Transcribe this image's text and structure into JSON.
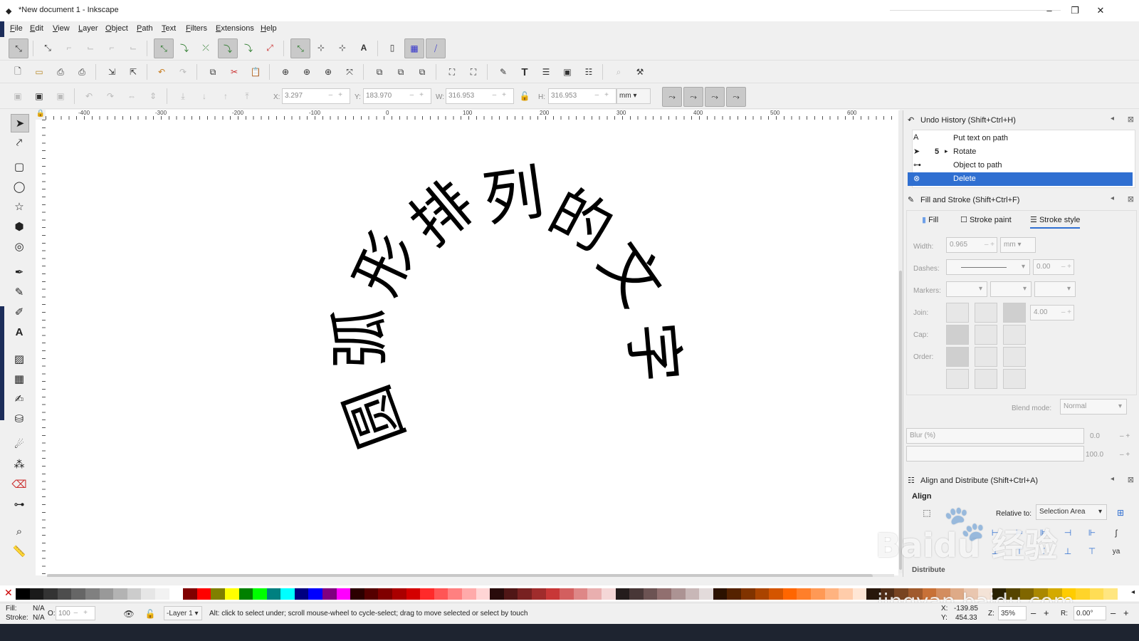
{
  "window": {
    "title": "*New document 1 - Inkscape",
    "controls": [
      "–",
      "❐",
      "✕"
    ]
  },
  "menu": [
    "File",
    "Edit",
    "View",
    "Layer",
    "Object",
    "Path",
    "Text",
    "Filters",
    "Extensions",
    "Help"
  ],
  "selector_toolbar": {
    "x_label": "X:",
    "x_value": "3.297",
    "y_label": "Y:",
    "y_value": "183.970",
    "w_label": "W:",
    "w_value": "316.953",
    "h_label": "H:",
    "h_value": "316.953",
    "unit": "mm"
  },
  "rulers": {
    "horizontal_ticks": [
      "-400",
      "-300",
      "-200",
      "-100",
      "0",
      "100",
      "200",
      "300",
      "400",
      "500",
      "600"
    ]
  },
  "canvas": {
    "arc_text": [
      "圆",
      "弧",
      "形",
      "排",
      "列",
      "的",
      "文",
      "字"
    ]
  },
  "undo_history": {
    "title": "Undo History (Shift+Ctrl+H)",
    "items": [
      {
        "icon": "text-icon",
        "count": "",
        "label": "Put text on path"
      },
      {
        "icon": "arrow-icon",
        "count": "5",
        "label": "Rotate"
      },
      {
        "icon": "node-icon",
        "count": "",
        "label": "Object to path"
      },
      {
        "icon": "delete-icon",
        "count": "",
        "label": "Delete",
        "selected": true
      }
    ]
  },
  "fill_stroke": {
    "title": "Fill and Stroke (Shift+Ctrl+F)",
    "tabs": [
      "Fill",
      "Stroke paint",
      "Stroke style"
    ],
    "active_tab": "Stroke style",
    "width_label": "Width:",
    "width_value": "0.965",
    "width_unit": "mm",
    "dashes_label": "Dashes:",
    "dashes_offset": "0.00",
    "markers_label": "Markers:",
    "join_label": "Join:",
    "miter_value": "4.00",
    "cap_label": "Cap:",
    "order_label": "Order:",
    "blend_label": "Blend mode:",
    "blend_value": "Normal",
    "blur_label": "Blur (%)",
    "blur_value": "0.0",
    "opacity_value": "100.0"
  },
  "align": {
    "title": "Align and Distribute (Shift+Ctrl+A)",
    "section": "Align",
    "relative_label": "Relative to:",
    "relative_value": "Selection Area",
    "distribute": "Distribute"
  },
  "status": {
    "fill_label": "Fill:",
    "fill_value": "N/A",
    "stroke_label": "Stroke:",
    "stroke_value": "N/A",
    "opacity_label": "O:",
    "opacity_value": "100",
    "layer": "-Layer 1",
    "message": "Alt: click to select under; scroll mouse-wheel to cycle-select; drag to move selected or select by touch",
    "x_label": "X:",
    "x_value": "-139.85",
    "y_label": "Y:",
    "y_value": "454.33",
    "zoom_label": "Z:",
    "zoom_value": "35%",
    "rotate_label": "R:",
    "rotate_value": "0.00°"
  },
  "watermark": {
    "brand": "Baidu 经验",
    "url": "jingyan.baidu.com"
  },
  "palette": [
    "#000000",
    "#1a1a1a",
    "#333333",
    "#4d4d4d",
    "#666666",
    "#808080",
    "#999999",
    "#b3b3b3",
    "#cccccc",
    "#e6e6e6",
    "#f2f2f2",
    "#ffffff",
    "#800000",
    "#ff0000",
    "#808000",
    "#ffff00",
    "#008000",
    "#00ff00",
    "#008080",
    "#00ffff",
    "#000080",
    "#0000ff",
    "#800080",
    "#ff00ff",
    "#2b0000",
    "#550000",
    "#800000",
    "#aa0000",
    "#d40000",
    "#ff2a2a",
    "#ff5555",
    "#ff8080",
    "#ffaaaa",
    "#ffd5d5",
    "#280b0b",
    "#501616",
    "#782121",
    "#a02c2c",
    "#c83737",
    "#d35f5f",
    "#de8787",
    "#e9afaf",
    "#f4d7d7",
    "#241c1c",
    "#483737",
    "#6c5353",
    "#916f6f",
    "#ac9393",
    "#c8b7b7",
    "#e3dbdb",
    "#2b1100",
    "#552200",
    "#803300",
    "#aa4400",
    "#d45500",
    "#ff6600",
    "#ff7f2a",
    "#ff9955",
    "#ffb380",
    "#ffccaa",
    "#ffe6d5",
    "#28170b",
    "#502d16",
    "#784421",
    "#a05a2c",
    "#c87137",
    "#d38d5f",
    "#deaa87",
    "#e9c6af",
    "#f4e3d7",
    "#2b2200",
    "#554400",
    "#806600",
    "#aa8800",
    "#d4aa00",
    "#ffcc00",
    "#ffd42a",
    "#ffdd55",
    "#ffe680"
  ]
}
